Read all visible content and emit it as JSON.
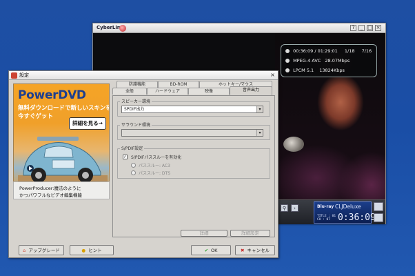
{
  "player": {
    "logo": "CyberLink",
    "window_buttons": [
      "?",
      "_",
      "□",
      "×"
    ],
    "osd": {
      "time_elapsed": "00:36:09",
      "time_total": "01:29:01",
      "chapter": "1/18",
      "title": "7/16",
      "video_format": "MPEG-4 AVC",
      "video_bitrate": "28.07Mbps",
      "audio_format": "LPCM 5.1",
      "audio_bitrate": "13824Kbps"
    },
    "controls": {
      "brand": "CLJDeluxe",
      "bd_logo": "Blu-ray",
      "title_label": "TITLE : 01",
      "chapter_label": "CH : 07",
      "timecode": "0:36:09"
    }
  },
  "dialog": {
    "title": "設定",
    "promo": {
      "title": "PowerDVD",
      "line1": "無料ダウンロードで新しいスキンを",
      "line2": "今すぐゲット",
      "button": "詳細を見る→",
      "caption1": "PowerProducer:魔法のように",
      "caption2": "かつパワフルなビデオ編集機能"
    },
    "tabs_row1": [
      "防護機能",
      "BD-ROM",
      "ホットキー/マウス"
    ],
    "tabs_row2": [
      "全般",
      "ハードウェア",
      "映像",
      "音声出力"
    ],
    "audio_output": {
      "group1_label": "スピーカー環境",
      "group1_value": "SPDIF出力",
      "group2_label": "サラウンド環境",
      "group2_value": "",
      "group3_label": "S/PDIF設定",
      "checkbox_label": "S/PDIFパススルーを有効化",
      "radio1": "パススルー: AC3",
      "radio2": "パススルー: DTS"
    },
    "panel_buttons": {
      "more": "詳細",
      "advanced": "詳細設定"
    },
    "footer": {
      "upgrade": "アップグレード",
      "hint": "ヒント",
      "ok": "OK",
      "cancel": "キャンセル"
    }
  }
}
